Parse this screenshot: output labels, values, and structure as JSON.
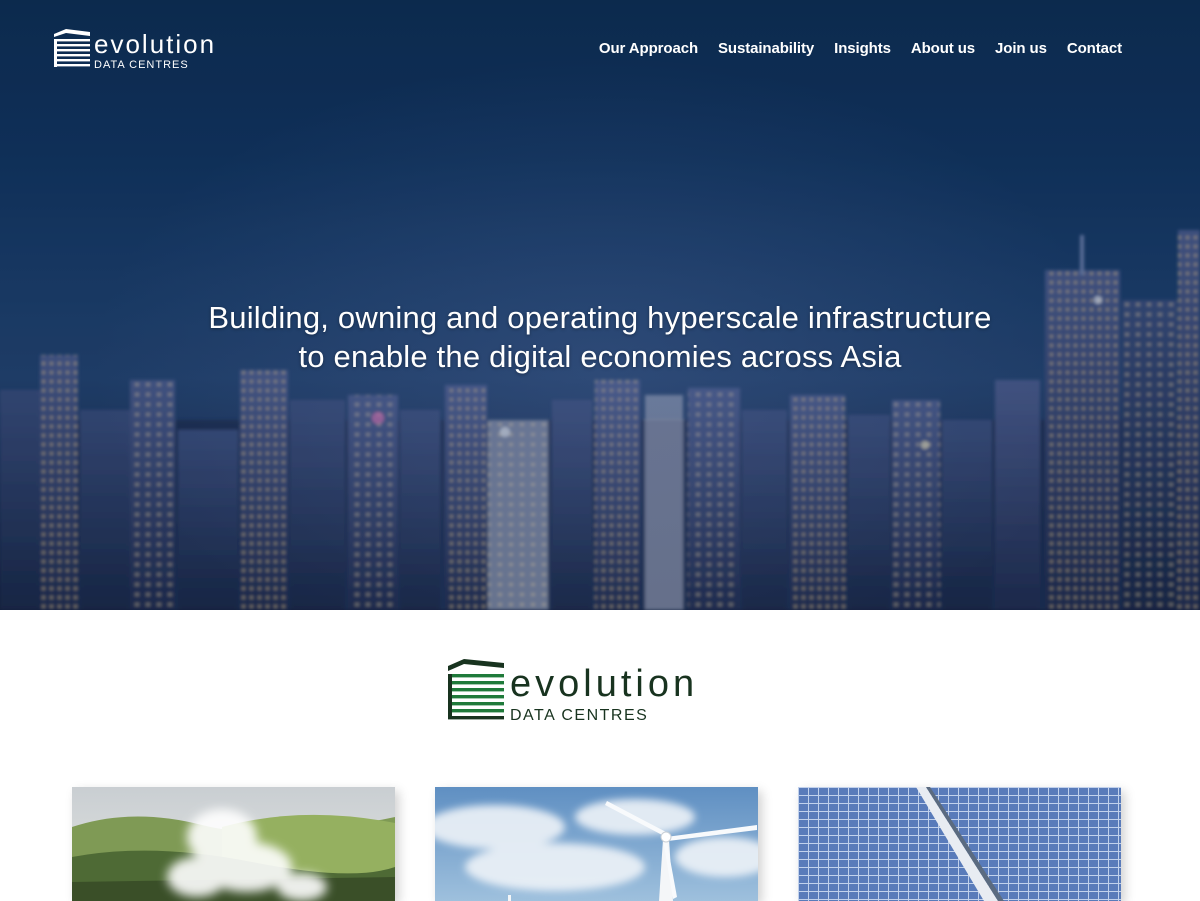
{
  "brand": {
    "name": "evolution",
    "subname": "DATA CENTRES"
  },
  "nav": {
    "items": [
      {
        "label": "Our Approach"
      },
      {
        "label": "Sustainability"
      },
      {
        "label": "Insights"
      },
      {
        "label": "About us"
      },
      {
        "label": "Join us"
      },
      {
        "label": "Contact"
      }
    ]
  },
  "hero": {
    "line1": "Building, owning and operating hyperscale infrastructure",
    "line2": "to enable the digital economies across Asia"
  },
  "colors": {
    "brand_green": "#1f7a3a",
    "brand_dark": "#18331f",
    "hero_navy": "#0d2a4e"
  },
  "cards": [
    {
      "name": "geothermal-image"
    },
    {
      "name": "wind-turbine-image"
    },
    {
      "name": "solar-panel-image"
    }
  ]
}
